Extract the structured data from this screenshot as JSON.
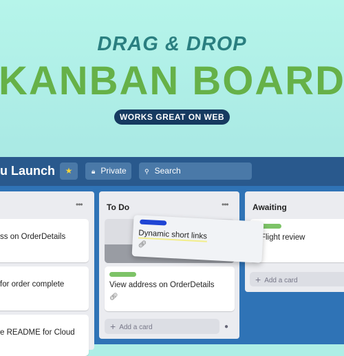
{
  "hero": {
    "subtitle": "DRAG & DROP",
    "title": "KANBAN BOARD",
    "badge": "WORKS GREAT ON WEB"
  },
  "header": {
    "board_name": "u Launch",
    "star_icon": "star-icon",
    "visibility": "Private",
    "search_placeholder": "Search"
  },
  "columns": [
    {
      "title": "",
      "cards": [
        "ss on OrderDetails",
        "for order complete",
        "e README for Cloud"
      ]
    },
    {
      "title": "To Do",
      "cards": [
        {
          "text": "View address on OrderDetails",
          "label_color": "#7dc367"
        }
      ],
      "add_label": "Add a card"
    },
    {
      "title": "Awaiting",
      "cards": [
        {
          "text": "stFlight review",
          "label_color": "#7dc367"
        }
      ],
      "add_label": "Add a card"
    }
  ],
  "dragging_card": {
    "text": "Dynamic short links",
    "label_color": "#1f45d4"
  },
  "colors": {
    "header": "#29598d",
    "board": "#2f73b6",
    "accent_green": "#66b148"
  }
}
